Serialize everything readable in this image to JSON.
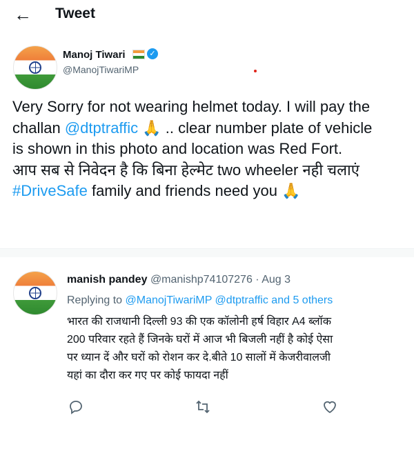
{
  "header": {
    "title": "Tweet",
    "back_icon": "arrow-left-icon"
  },
  "tweet": {
    "author_name": "Manoj Tiwari",
    "author_handle": "@ManojTiwariMP",
    "badges": [
      "indian-flag-emoji",
      "verified-badge-icon"
    ],
    "lines": [
      [
        "Very Sorry for not wearing helmet today. I will pay the",
        ""
      ],
      [
        "challan ",
        "@dtptraffic",
        " 🙏 .. clear number plate of vehicle"
      ],
      [
        "is shown in this photo and location was Red Fort.",
        ""
      ],
      [
        "आप सब से निवेदन है कि बिना हेल्मेट two wheeler नही चलाएं",
        ""
      ],
      [
        "",
        "#DriveSafe",
        " family and friends need you 🙏"
      ]
    ]
  },
  "reply": {
    "author_name": "manish pandey",
    "author_handle": "@manishp74107276",
    "separator": " · ",
    "date": "Aug 3",
    "replying_prefix": "Replying to ",
    "replying_to": "@ManojTiwariMP @dtptraffic and 5 others",
    "lines": [
      "भारत की राजधानी दिल्ली 93 की एक कॉलोनी हर्ष विहार A4 ब्लॉक",
      "200 परिवार रहते हैं जिनके घरों में आज भी बिजली नहीं है  कोई ऐसा",
      "पर ध्यान दें और घरों को रोशन कर दे.बीते 10 सालों में केजरीवालजी",
      "यहां का दौरा कर गए पर कोई फायदा नहीं"
    ],
    "actions": [
      "reply-icon",
      "retweet-icon",
      "like-icon"
    ]
  },
  "colors": {
    "link": "#1d9bf0",
    "muted": "#536471",
    "text": "#0f1419"
  }
}
